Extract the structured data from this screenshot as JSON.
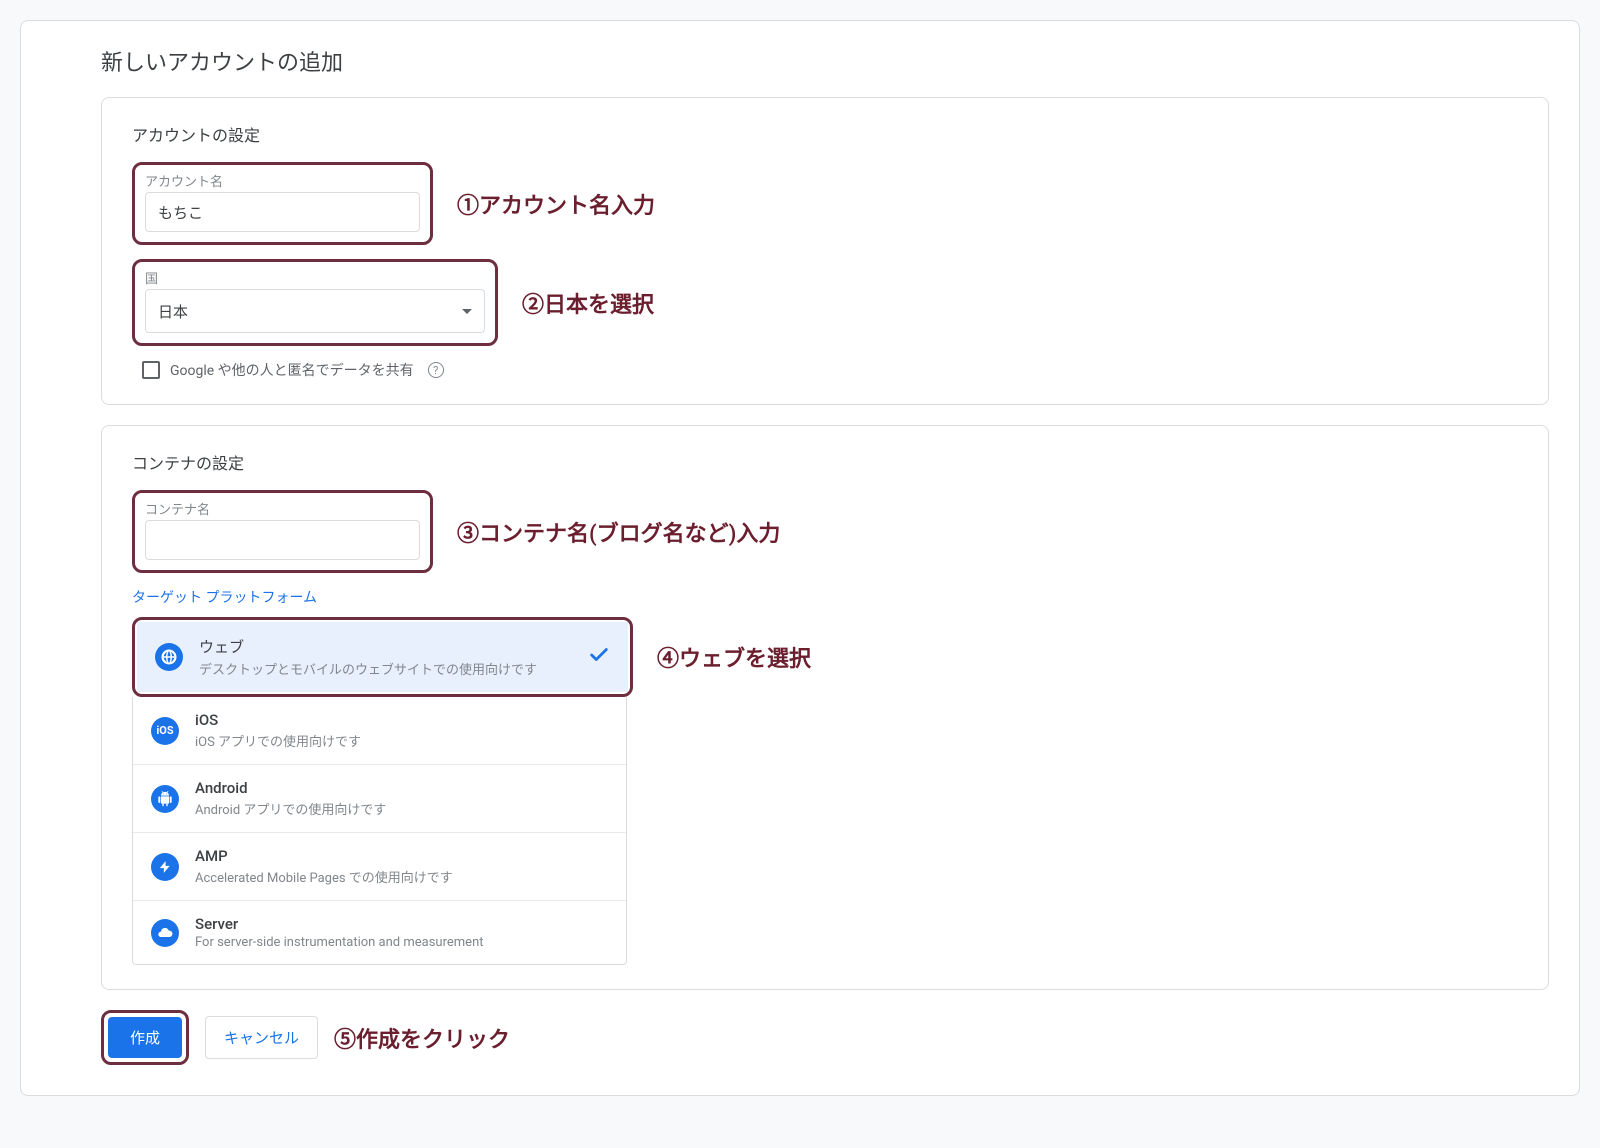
{
  "page_title": "新しいアカウントの追加",
  "account_section": {
    "title": "アカウントの設定",
    "name_label": "アカウント名",
    "name_value": "もちこ",
    "country_label": "国",
    "country_value": "日本",
    "share_label": "Google や他の人と匿名でデータを共有"
  },
  "container_section": {
    "title": "コンテナの設定",
    "name_label": "コンテナ名",
    "name_value": "",
    "platform_label": "ターゲット プラットフォーム",
    "platforms": [
      {
        "name": "ウェブ",
        "desc": "デスクトップとモバイルのウェブサイトでの使用向けです",
        "selected": true
      },
      {
        "name": "iOS",
        "desc": "iOS アプリでの使用向けです",
        "selected": false
      },
      {
        "name": "Android",
        "desc": "Android アプリでの使用向けです",
        "selected": false
      },
      {
        "name": "AMP",
        "desc": "Accelerated Mobile Pages での使用向けです",
        "selected": false
      },
      {
        "name": "Server",
        "desc": "For server-side instrumentation and measurement",
        "selected": false
      }
    ]
  },
  "buttons": {
    "create": "作成",
    "cancel": "キャンセル"
  },
  "annotations": {
    "a1": "①アカウント名入力",
    "a2": "②日本を選択",
    "a3": "③コンテナ名(ブログ名など)入力",
    "a4": "④ウェブを選択",
    "a5": "⑤作成をクリック"
  }
}
